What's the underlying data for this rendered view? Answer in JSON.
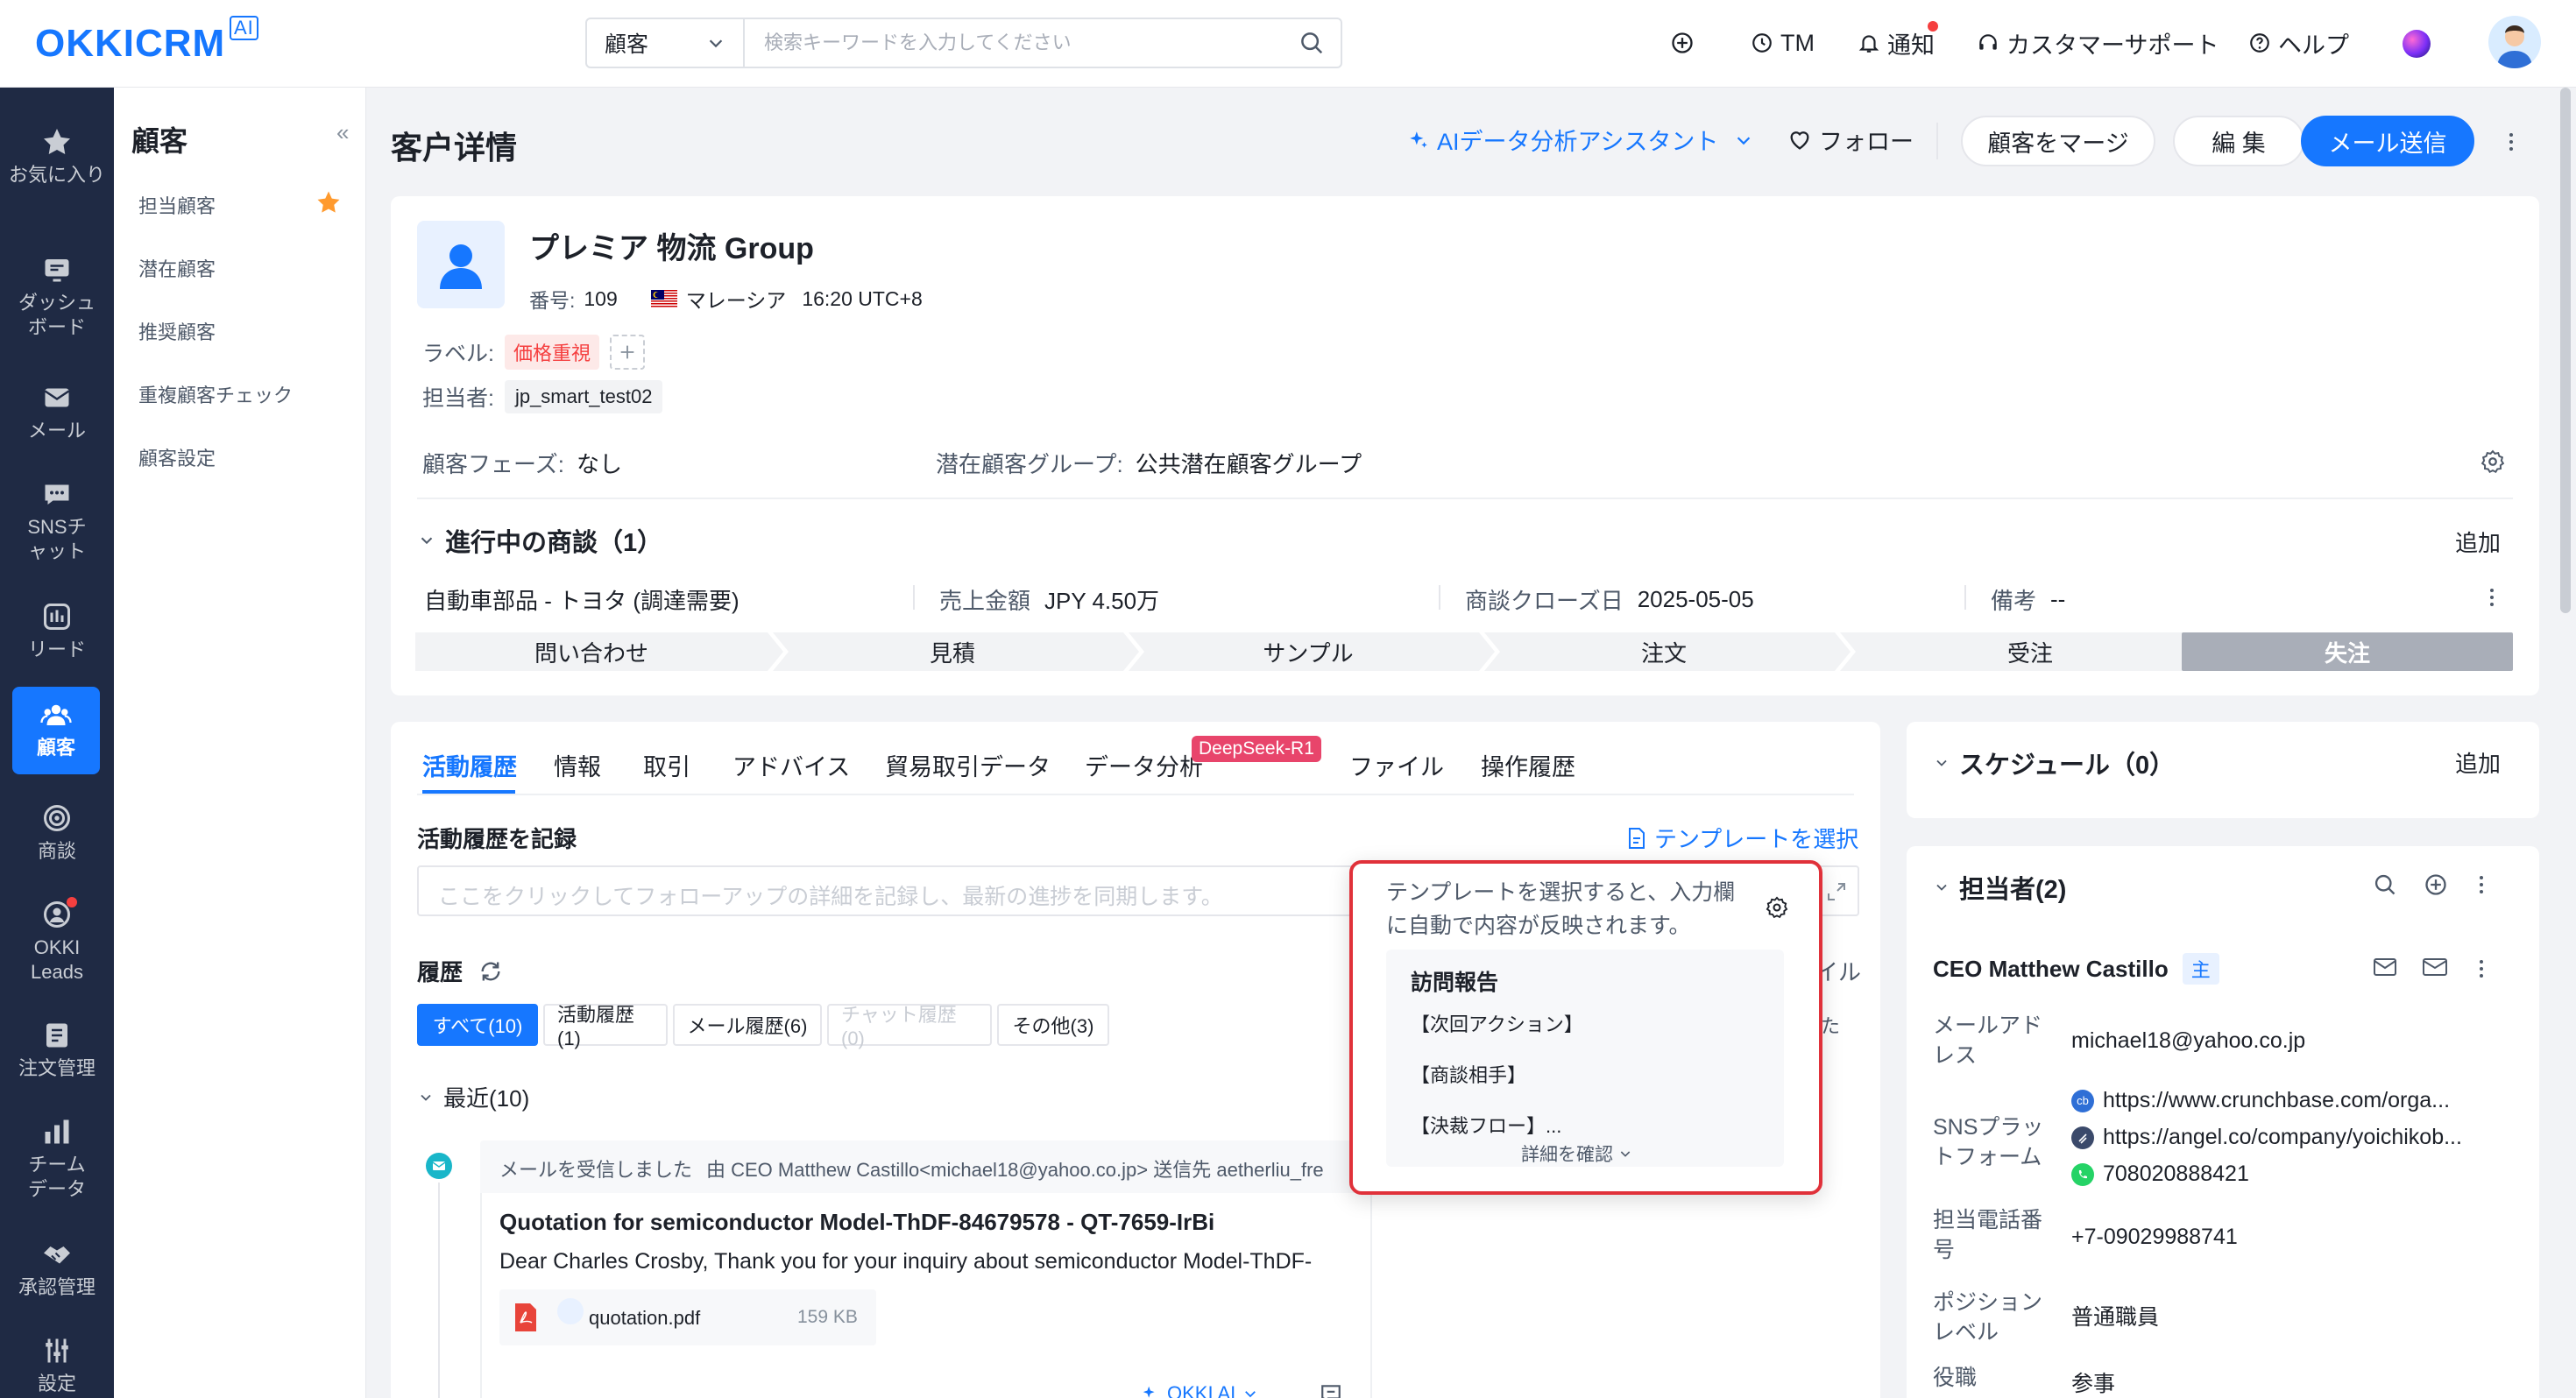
{
  "topbar": {
    "logo": "OKKICRM",
    "logo_ai": "AI",
    "search_type": "顧客",
    "search_placeholder": "検索キーワードを入力してください",
    "tm": "TM",
    "notify": "通知",
    "support": "カスタマーサポート",
    "help": "ヘルプ"
  },
  "leftnav": [
    {
      "label": "お気に入り",
      "icon": "star-icon"
    },
    {
      "label": "ダッシュボード",
      "icon": "dashboard-icon"
    },
    {
      "label": "メール",
      "icon": "mail-icon"
    },
    {
      "label": "SNSチャット",
      "icon": "chat-icon"
    },
    {
      "label": "リード",
      "icon": "lead-icon"
    },
    {
      "label": "顧客",
      "icon": "customers-icon"
    },
    {
      "label": "商談",
      "icon": "target-icon"
    },
    {
      "label": "OKKI Leads",
      "icon": "okki-leads-icon"
    },
    {
      "label": "注文管理",
      "icon": "order-icon"
    },
    {
      "label": "チームデータ",
      "icon": "bar-chart-icon"
    },
    {
      "label": "承認管理",
      "icon": "handshake-icon"
    },
    {
      "label": "設定",
      "icon": "settings-icon"
    }
  ],
  "subnav": {
    "title": "顧客",
    "collapse": "«",
    "items": [
      "担当顧客",
      "潜在顧客",
      "推奨顧客",
      "重複顧客チェック",
      "顧客設定"
    ]
  },
  "header": {
    "title": "客户详情",
    "ai_assist": "AIデータ分析アシスタント",
    "follow": "フォロー",
    "merge": "顧客をマージ",
    "edit": "編 集",
    "send_mail": "メール送信"
  },
  "customer": {
    "name": "プレミア 物流 Group",
    "number_label": "番号:",
    "number": "109",
    "country": "マレーシア",
    "time": "16:20 UTC+8",
    "label_key": "ラベル:",
    "label_tag": "価格重視",
    "owner_key": "担当者:",
    "owner": "jp_smart_test02",
    "phase_key": "顧客フェーズ:",
    "phase": "なし",
    "group_key": "潜在顧客グループ:",
    "group": "公共潜在顧客グループ"
  },
  "deals": {
    "title": "進行中の商談（1）",
    "add": "追加",
    "name": "自動車部品 - トヨタ (調達需要)",
    "amount_key": "売上金額",
    "amount": "JPY 4.50万",
    "close_key": "商談クローズ日",
    "close": "2025-05-05",
    "note_key": "備考",
    "note": "--",
    "stages": [
      "問い合わせ",
      "見積",
      "サンプル",
      "注文",
      "受注",
      "失注"
    ]
  },
  "activity": {
    "tabs": [
      "活動履歴",
      "情報",
      "取引",
      "アドバイス",
      "貿易取引データ",
      "データ分析",
      "ファイル",
      "操作履歴"
    ],
    "deepseek_badge": "DeepSeek-R1",
    "record_title": "活動履歴を記録",
    "template_link": "テンプレートを選択",
    "input_placeholder": "ここをクリックしてフォローアップの詳細を記録し、最新の進捗を同期します。",
    "history_title": "履歴",
    "filters": [
      "すべて(10)",
      "活動履歴(1)",
      "メール履歴(6)",
      "チャット履歴(0)",
      "その他(3)"
    ],
    "recent": "最近(10)",
    "mail_event": "メールを受信しました",
    "mail_from": "由 CEO Matthew Castillo<michael18@yahoo.co.jp> 送信先 aetherliu_fre",
    "mail_subject": "Quotation for semiconductor Model-ThDF-84679578 - QT-7659-IrBi",
    "mail_body": "Dear Charles Crosby, Thank you for your inquiry about semiconductor Model-ThDF-",
    "attachment_name": "quotation.pdf",
    "attachment_size": "159 KB",
    "okki_ai": "OKKI AI",
    "right_fragment_1": "イル",
    "right_fragment_2": "た",
    "right_fragment_3": "3"
  },
  "popup": {
    "desc": "テンプレートを選択すると、入力欄に自動で内容が反映されます。",
    "template_title": "訪問報告",
    "lines": [
      "【次回アクション】",
      "【商談相手】",
      "【決裁フロー】..."
    ],
    "more": "詳細を確認"
  },
  "schedule": {
    "title": "スケジュール（0）",
    "add": "追加"
  },
  "contacts": {
    "title": "担当者(2)",
    "person": "CEO Matthew Castillo",
    "primary": "主",
    "email_key": "メールアドレス",
    "email": "michael18@yahoo.co.jp",
    "sns_key": "SNSプラットフォーム",
    "sns": [
      "https://www.crunchbase.com/orga...",
      "https://angel.co/company/yoichikob...",
      "708020888421"
    ],
    "phone_key": "担当電話番号",
    "phone": "+7-09029988741",
    "position_key": "ポジションレベル",
    "position": "普通職員",
    "role_key": "役職",
    "role": "参事"
  },
  "colors": {
    "accent": "#1677ff",
    "nav_bg": "#1f2a44",
    "danger": "#f53f3f",
    "popup_border": "#e0313a"
  }
}
